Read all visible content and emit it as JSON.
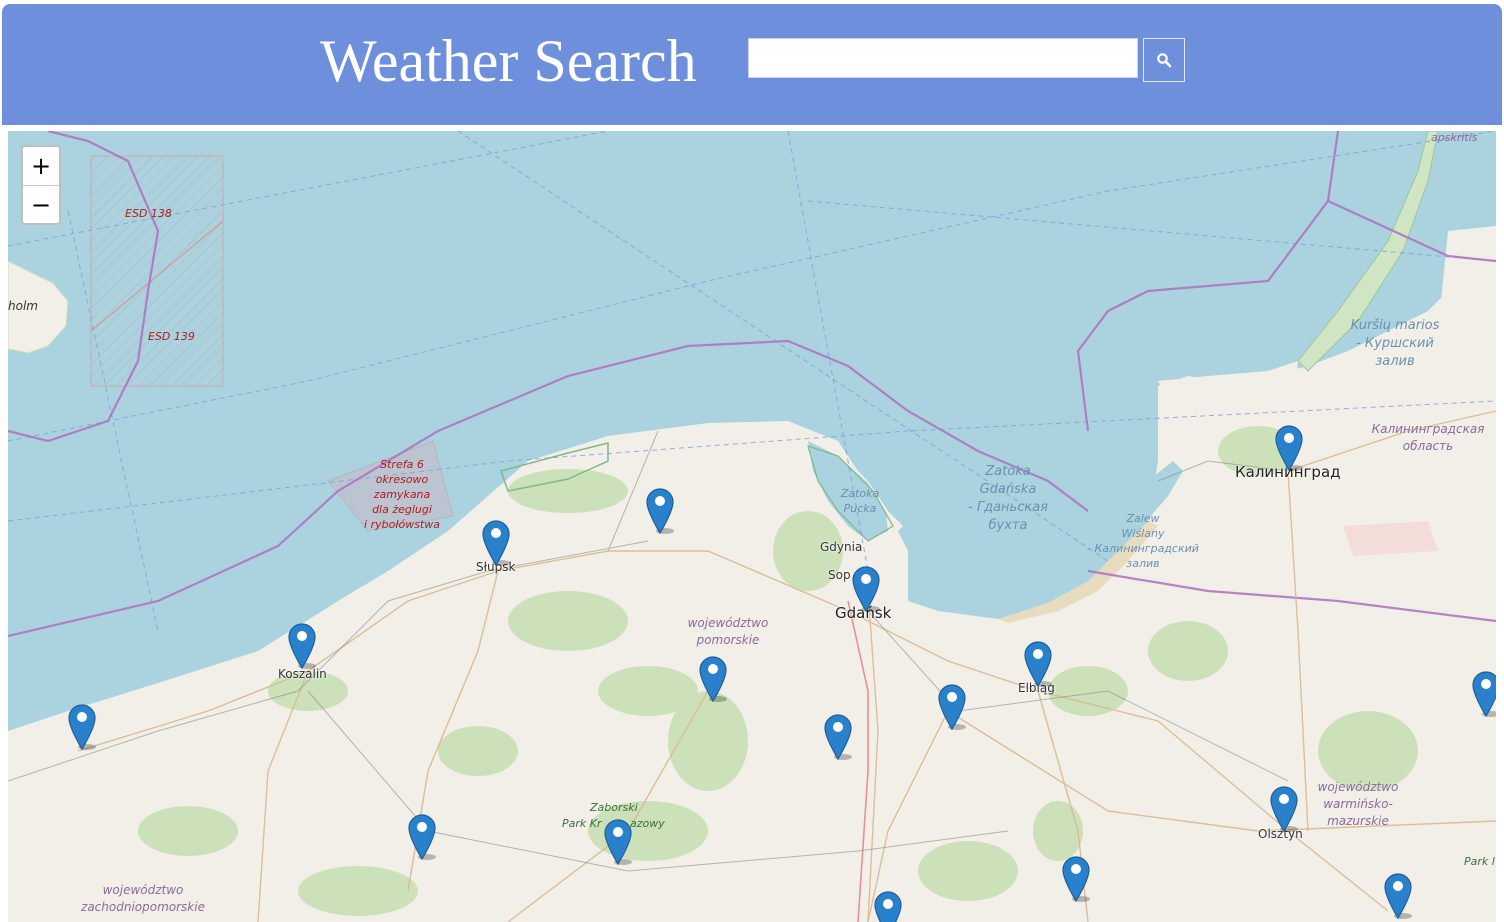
{
  "header": {
    "title": "Weather Search"
  },
  "search": {
    "placeholder": "",
    "value": "",
    "button_icon": "search-icon"
  },
  "map": {
    "zoom_in_label": "+",
    "zoom_out_label": "−",
    "labels": {
      "holm": "holm",
      "esd138": "ESD 138",
      "esd139": "ESD 139",
      "strefa": [
        "Strefa 6",
        "okresowo",
        "zamykana",
        "dla żeglugi",
        "i rybołówstwa"
      ],
      "slupsk": "Słupsk",
      "koszalin": "Koszalin",
      "gdynia": "Gdynia",
      "sopot": "Sop",
      "gdansk": "Gdańsk",
      "elblag": "Elbląg",
      "olsztyn": "Olsztyn",
      "kaliningrad": "Калининград",
      "zatoka_pucka": [
        "Zatoka",
        "Pucka"
      ],
      "zatoka_gdanska": [
        "Zatoka",
        "Gdańska",
        "- Гданьская",
        "бухта"
      ],
      "zalew": [
        "Zalew",
        "Wiślany",
        "- Калининградский",
        "залив"
      ],
      "kursiu": [
        "Kuršių marios",
        "- Куршский",
        "залив"
      ],
      "kalin_obl": [
        "Калининградская",
        "область"
      ],
      "pomorskie": [
        "województwo",
        "pomorskie"
      ],
      "zachodniopomorskie": [
        "województwo",
        "zachodniopomorskie"
      ],
      "warminsko": [
        "województwo",
        "warmińsko-",
        "mazurskie"
      ],
      "zaborski": [
        "Zaborski",
        "Park Kr",
        "azowy"
      ],
      "apskritis": "apskritis",
      "park_l": "Park l"
    },
    "markers_count": 19
  },
  "colors": {
    "header": "#6d8fdc",
    "water": "#aad3df",
    "land": "#f2efe9",
    "forest": "#c8dfb4",
    "marker": "#2a81cb",
    "border": "#b06fbf"
  }
}
